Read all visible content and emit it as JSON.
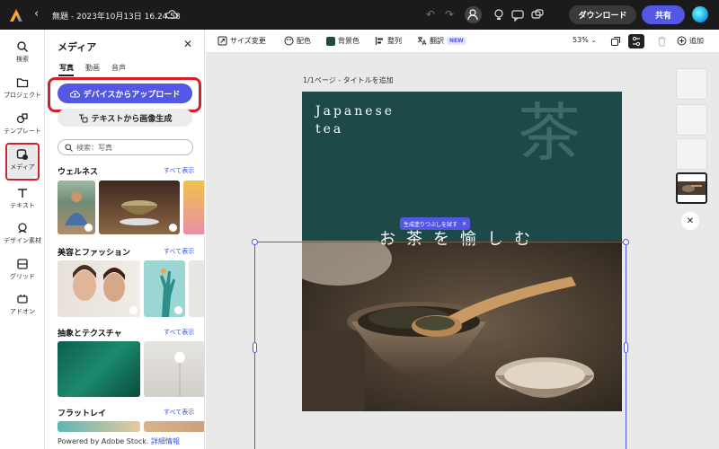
{
  "header": {
    "doc_title": "無題 - 2023年10月13日 16.24.58",
    "download_label": "ダウンロード",
    "share_label": "共有"
  },
  "rail": {
    "items": [
      {
        "label": "検索",
        "icon": "search-icon"
      },
      {
        "label": "プロジェクト",
        "icon": "folder-icon"
      },
      {
        "label": "テンプレート",
        "icon": "template-icon"
      },
      {
        "label": "メディア",
        "icon": "media-icon"
      },
      {
        "label": "テキスト",
        "icon": "text-icon"
      },
      {
        "label": "デザイン素材",
        "icon": "shapes-icon"
      },
      {
        "label": "グリッド",
        "icon": "grid-icon"
      },
      {
        "label": "アドオン",
        "icon": "addon-icon"
      }
    ]
  },
  "panel": {
    "title": "メディア",
    "tabs": [
      "写真",
      "動画",
      "音声"
    ],
    "upload_label": "デバイスからアップロード",
    "text_to_image_label": "テキストから画像生成",
    "search_placeholder": "検索：写真",
    "see_all": "すべて表示",
    "sections": [
      "ウェルネス",
      "美容とファッション",
      "抽象とテクスチャ",
      "フラットレイ"
    ],
    "powered_prefix": "Powered by Adobe Stock.",
    "powered_link": "詳細情報"
  },
  "toolbar": {
    "resize": "サイズ変更",
    "color": "配色",
    "background_color": "背景色",
    "align": "整列",
    "translate": "翻訳",
    "new_badge": "NEW",
    "zoom": "53%",
    "add": "追加"
  },
  "canvas": {
    "page_label": "1/1ページ - タイトルを追加",
    "design_title": "Japanese\ntea",
    "big_char": "茶",
    "catchphrase": "お茶を愉しむ",
    "genfill_label": "生成塗りつぶしを試す",
    "genfill_close": "✕"
  },
  "colors": {
    "accent": "#5258e4",
    "highlight": "#d3202a",
    "design_bg": "#1d4a48",
    "topbar": "#1b1b1b"
  }
}
